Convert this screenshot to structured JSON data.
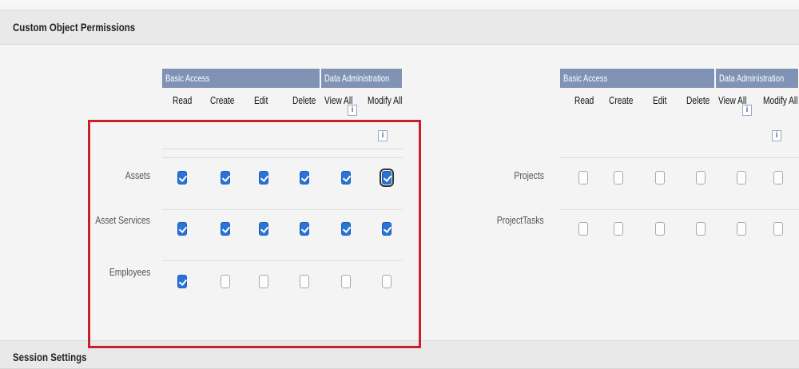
{
  "section_custom": "Custom Object Permissions",
  "section_session": "Session Settings",
  "groups": {
    "basic": "Basic Access",
    "admin": "Data Administration"
  },
  "columns": {
    "read": "Read",
    "create": "Create",
    "edit": "Edit",
    "delete": "Delete",
    "view_all": "View All",
    "modify_all": "Modify All"
  },
  "info_glyph": "i",
  "left_rows": [
    {
      "label": "Assets",
      "read": true,
      "create": true,
      "edit": true,
      "delete": true,
      "view_all": true,
      "modify_all": true
    },
    {
      "label": "Asset Services",
      "read": true,
      "create": true,
      "edit": true,
      "delete": true,
      "view_all": true,
      "modify_all": true
    },
    {
      "label": "Employees",
      "read": true,
      "create": false,
      "edit": false,
      "delete": false,
      "view_all": false,
      "modify_all": false
    }
  ],
  "right_rows": [
    {
      "label": "Projects",
      "read": false,
      "create": false,
      "edit": false,
      "delete": false,
      "view_all": false,
      "modify_all": false
    },
    {
      "label": "ProjectTasks",
      "read": false,
      "create": false,
      "edit": false,
      "delete": false,
      "view_all": false,
      "modify_all": false
    }
  ],
  "colors": {
    "header_bar": "#8093b4",
    "checkbox_on": "#2a74d9",
    "highlight_box": "#cc1f2a"
  },
  "icons": {
    "info": "info-icon",
    "check": "checkmark-icon"
  }
}
